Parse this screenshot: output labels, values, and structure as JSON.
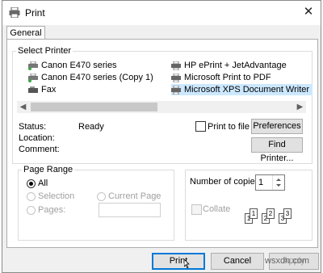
{
  "window": {
    "title": "Print"
  },
  "tabs": [
    {
      "label": "General"
    }
  ],
  "select_printer": {
    "legend": "Select Printer",
    "printers_left": [
      {
        "name": "Canon E470 series"
      },
      {
        "name": "Canon E470 series (Copy 1)"
      },
      {
        "name": "Fax"
      }
    ],
    "printers_right": [
      {
        "name": "HP ePrint + JetAdvantage"
      },
      {
        "name": "Microsoft Print to PDF"
      },
      {
        "name": "Microsoft XPS Document Writer",
        "selected": true
      }
    ],
    "status_label": "Status:",
    "status_value": "Ready",
    "location_label": "Location:",
    "comment_label": "Comment:",
    "print_to_file_label": "Print to file",
    "print_to_file_checked": false,
    "preferences_label": "Preferences",
    "find_printer_label": "Find Printer..."
  },
  "page_range": {
    "legend": "Page Range",
    "all_label": "All",
    "selection_label": "Selection",
    "current_page_label": "Current Page",
    "pages_label": "Pages:",
    "pages_value": "",
    "selected": "All"
  },
  "copies": {
    "number_label": "Number of copies:",
    "value": "1",
    "collate_label": "Collate",
    "collate_checked": false
  },
  "buttons": {
    "print_label": "Print",
    "cancel_label": "Cancel",
    "apply_label": "Apply"
  },
  "watermark": "wsxdn.com"
}
